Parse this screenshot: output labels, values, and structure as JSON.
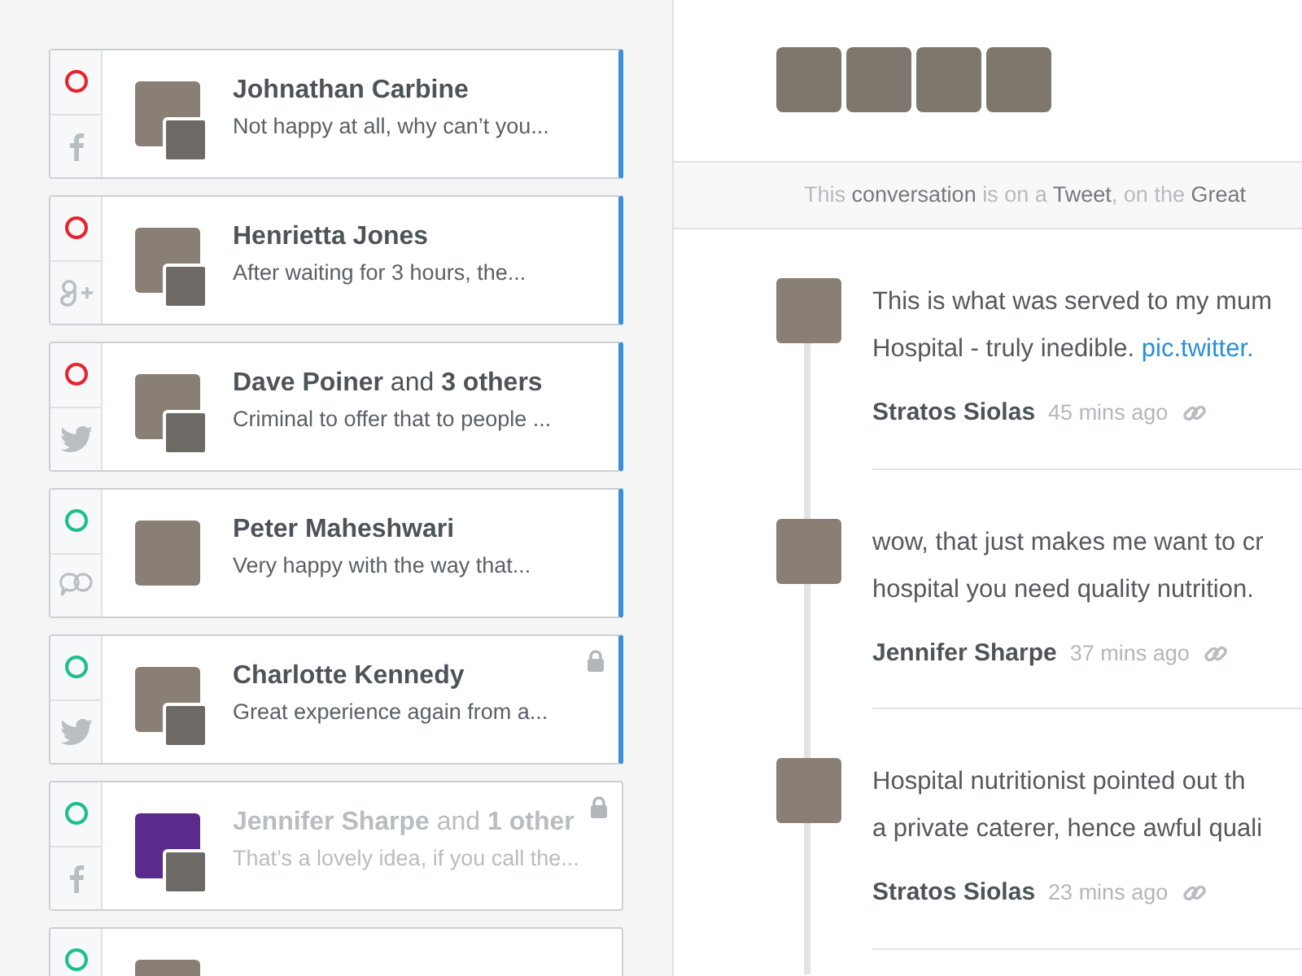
{
  "conversations": [
    {
      "name": "**Johnathan Carbine**",
      "preview": "Not happy at all, why can’t you...",
      "color": "#e8232d",
      "network": {
        "kind": "facebook"
      },
      "avatars": [
        {
          "kind": "person"
        },
        {
          "kind": "person"
        }
      ],
      "highlighted": true,
      "dimmed": false,
      "locked": false
    },
    {
      "name": "**Henrietta Jones**",
      "preview": "After waiting for 3 hours, the...",
      "color": "#e8232d",
      "network": {
        "kind": "googleplus"
      },
      "avatars": [
        {
          "kind": "person"
        },
        {
          "kind": "person"
        }
      ],
      "highlighted": true,
      "dimmed": false,
      "locked": false
    },
    {
      "name": "**Dave Poiner** and **3 others**",
      "preview": "Criminal to offer that to people ...",
      "color": "#e8232d",
      "network": {
        "kind": "twitter"
      },
      "avatars": [
        {
          "kind": "person"
        },
        {
          "kind": "person"
        }
      ],
      "highlighted": true,
      "dimmed": false,
      "locked": false
    },
    {
      "name": "**Peter Maheshwari**",
      "preview": "Very happy with the way that...",
      "color": "#1dbf8e",
      "network": {
        "kind": "chat"
      },
      "avatars": [
        {
          "kind": "person"
        }
      ],
      "highlighted": true,
      "dimmed": false,
      "locked": false
    },
    {
      "name": "**Charlotte Kennedy**",
      "preview": "Great experience again from a...",
      "color": "#1dbf8e",
      "network": {
        "kind": "twitter"
      },
      "avatars": [
        {
          "kind": "person"
        },
        {
          "kind": "person"
        }
      ],
      "highlighted": true,
      "dimmed": false,
      "locked": true
    },
    {
      "name": "**Jennifer Sharpe** and **1 other**",
      "preview": "That’s a lovely idea, if you call the...",
      "color": "#1dbf8e",
      "network": {
        "kind": "facebook"
      },
      "avatars": [
        {
          "kind": "logo"
        },
        {
          "kind": "person"
        }
      ],
      "highlighted": false,
      "dimmed": true,
      "locked": true
    },
    {
      "color": "#1dbf8e",
      "avatars": [
        {
          "kind": "person"
        }
      ],
      "highlighted": false
    }
  ],
  "participants": [
    {
      "kind": "person"
    },
    {
      "kind": "person"
    },
    {
      "kind": "person"
    },
    {
      "kind": "person"
    }
  ],
  "notice": [
    {
      "text": "This",
      "emphasis": false
    },
    {
      "text": "conversation",
      "emphasis": true
    },
    {
      "text": "is on a",
      "emphasis": false
    },
    {
      "text": "Tweet",
      "emphasis": true
    },
    {
      "text": ", on the",
      "emphasis": false
    },
    {
      "text": "Great",
      "emphasis": true
    }
  ],
  "messages": [
    {
      "lines": [
        "This is what was served to my mum",
        "Hospital - truly inedible."
      ],
      "link": "pic.twitter.",
      "author": "Stratos Siolas",
      "time": "45 mins ago"
    },
    {
      "lines": [
        "wow, that just makes me want to cr",
        "hospital you need quality nutrition."
      ],
      "author": "Jennifer Sharpe",
      "time": "37 mins ago"
    },
    {
      "lines": [
        "Hospital nutritionist pointed out th",
        "a private caterer, hence awful quali"
      ],
      "author": "Stratos Siolas",
      "time": "23 mins ago"
    }
  ]
}
